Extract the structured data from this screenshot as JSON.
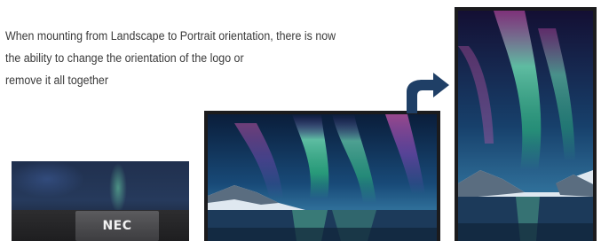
{
  "description": {
    "lines": [
      "When mounting from Landscape to Portrait orientation, there is now",
      "the ability to change the orientation of the logo or",
      "remove it all together"
    ]
  },
  "logo_detail": {
    "logo_text": "NEC"
  },
  "icons": {
    "rotate_arrow": "curved-arrow-up-right-icon"
  },
  "colors": {
    "text": "#3a3a3a",
    "arrow": "#1f3f66",
    "bezel": "#1b1b1d"
  }
}
